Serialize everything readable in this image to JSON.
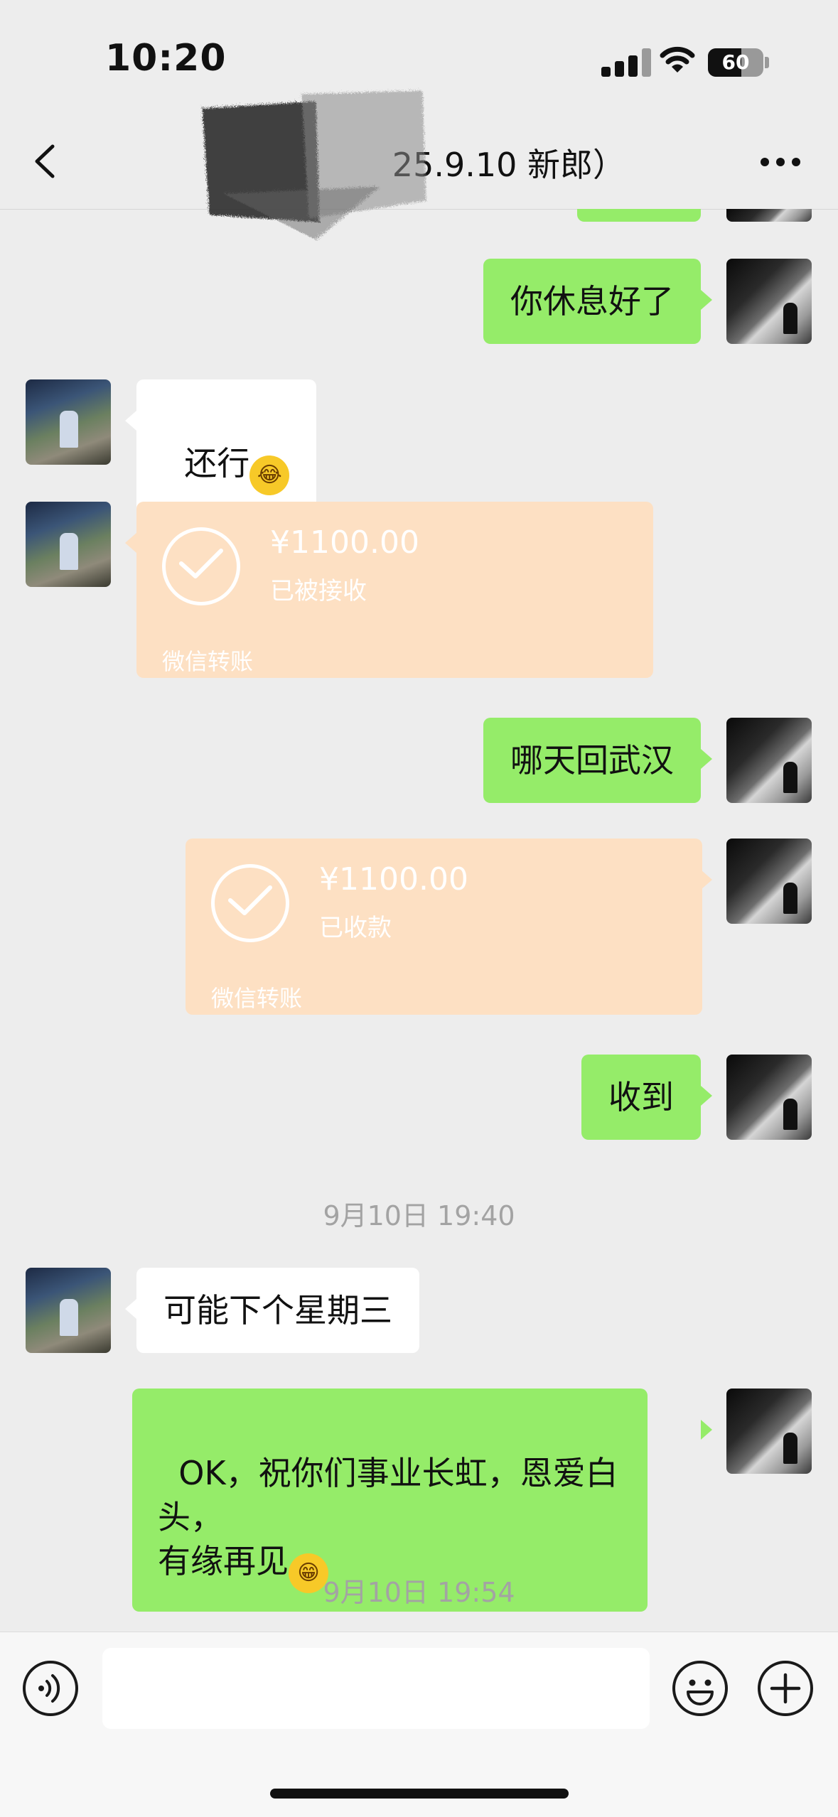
{
  "status_bar": {
    "time": "10:20",
    "battery": "60",
    "battery_level": 0.6
  },
  "nav": {
    "title_visible": "25.9.10 新郎）"
  },
  "messages": [
    {
      "side": "me",
      "type": "text",
      "text": "你休息好了"
    },
    {
      "side": "friend",
      "type": "text",
      "text": "还行",
      "emoji": "tears-of-joy"
    },
    {
      "side": "friend",
      "type": "transfer",
      "amount": "¥1100.00",
      "status": "已被接收",
      "label": "微信转账"
    },
    {
      "side": "me",
      "type": "text",
      "text": "哪天回武汉"
    },
    {
      "side": "me",
      "type": "transfer",
      "amount": "¥1100.00",
      "status": "已收款",
      "label": "微信转账"
    },
    {
      "side": "me",
      "type": "text",
      "text": "收到"
    },
    {
      "type": "timestamp",
      "text": "9月10日 19:40"
    },
    {
      "side": "friend",
      "type": "text",
      "text": "可能下个星期三"
    },
    {
      "side": "me",
      "type": "text",
      "text": "OK，祝你们事业长虹，恩爱白头，\n有缘再见",
      "emoji": "grinning"
    },
    {
      "type": "timestamp",
      "text": "9月10日 19:54"
    }
  ],
  "input_bar": {
    "voice_icon": "voice-icon",
    "emoji_icon": "smile-icon",
    "plus_icon": "plus-icon"
  },
  "colors": {
    "my_bubble": "#95ec69",
    "friend_bubble": "#ffffff",
    "transfer_card": "#fde0c3",
    "background": "#ededed"
  }
}
